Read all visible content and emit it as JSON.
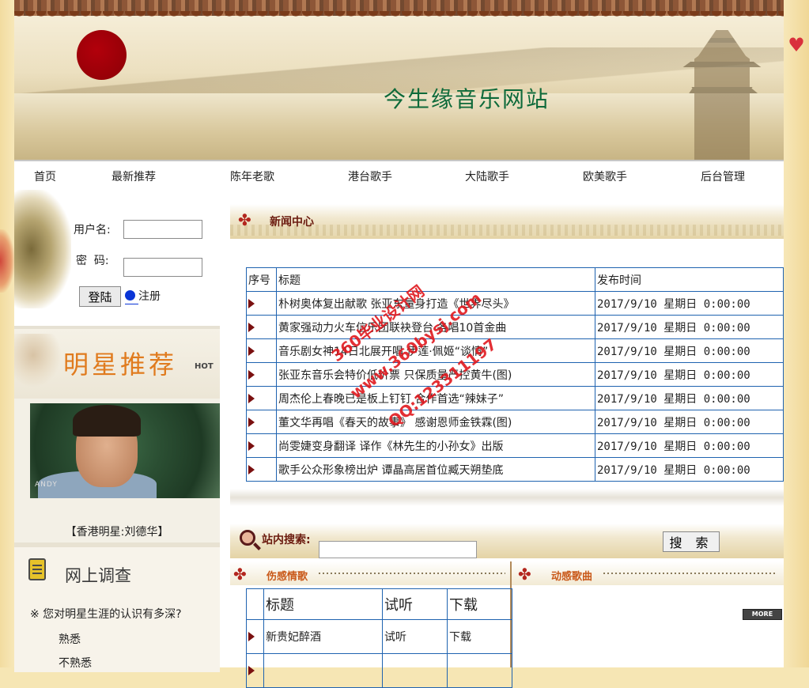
{
  "site": {
    "title": "今生缘音乐网站"
  },
  "nav": {
    "items": [
      {
        "label": "首页"
      },
      {
        "label": "最新推荐"
      },
      {
        "label": "陈年老歌"
      },
      {
        "label": "港台歌手"
      },
      {
        "label": "大陆歌手"
      },
      {
        "label": "欧美歌手"
      },
      {
        "label": "后台管理"
      }
    ]
  },
  "login": {
    "username_label": "用户名:",
    "password_label": "密  码:",
    "username_value": "",
    "password_value": "",
    "login_button": "登陆",
    "register_link": "注册"
  },
  "star": {
    "title": "明星推荐",
    "badge": "HOT",
    "photo_tag": "ANDY",
    "caption": "【香港明星:刘德华】"
  },
  "survey": {
    "title": "网上调查",
    "question": "※ 您对明星生涯的认识有多深?",
    "options": [
      "熟悉",
      "不熟悉"
    ]
  },
  "news": {
    "title": "新闻中心",
    "columns": [
      "序号",
      "标题",
      "发布时间"
    ],
    "rows": [
      {
        "title": "朴树奥体复出献歌 张亚东量身打造《世界尽头》",
        "date": "2017/9/10 星期日 0:00:00"
      },
      {
        "title": "黄家强动力火车信乐团联袂登台 各唱10首金曲",
        "date": "2017/9/10 星期日 0:00:00"
      },
      {
        "title": "音乐剧女神14日北展开唱 伊莲·佩姬“谈情”",
        "date": "2017/9/10 星期日 0:00:00"
      },
      {
        "title": "张亚东音乐会特价低价票 只保质量严控黄牛(图)",
        "date": "2017/9/10 星期日 0:00:00"
      },
      {
        "title": "周杰伦上春晚已是板上钉钉 合作首选“辣妹子”",
        "date": "2017/9/10 星期日 0:00:00"
      },
      {
        "title": "董文华再唱《春天的故事》 感谢恩师金铁霖(图)",
        "date": "2017/9/10 星期日 0:00:00"
      },
      {
        "title": "尚雯婕变身翻译 译作《林先生的小孙女》出版",
        "date": "2017/9/10 星期日 0:00:00"
      },
      {
        "title": "歌手公众形象榜出炉 谭晶高居首位臧天朔垫底",
        "date": "2017/9/10 星期日 0:00:00"
      }
    ]
  },
  "search": {
    "label": "站内搜索:",
    "value": "",
    "button": "搜 索"
  },
  "sad_songs": {
    "title": "伤感情歌",
    "columns": [
      "标题",
      "试听",
      "下载"
    ],
    "rows": [
      {
        "title": "新贵妃醉酒",
        "listen": "试听",
        "download": "下载"
      },
      {
        "title": "",
        "listen": "",
        "download": ""
      }
    ]
  },
  "dynamic_songs": {
    "title": "动感歌曲",
    "more": "MORE"
  },
  "watermark": {
    "lines": [
      "360毕业设计网",
      "www.360bysj.com",
      "QQ:123311197"
    ]
  },
  "colors": {
    "accent_red": "#b3261e",
    "title_green": "#0e6a3a",
    "table_border": "#1f63b0",
    "star_orange": "#e07b1e"
  }
}
